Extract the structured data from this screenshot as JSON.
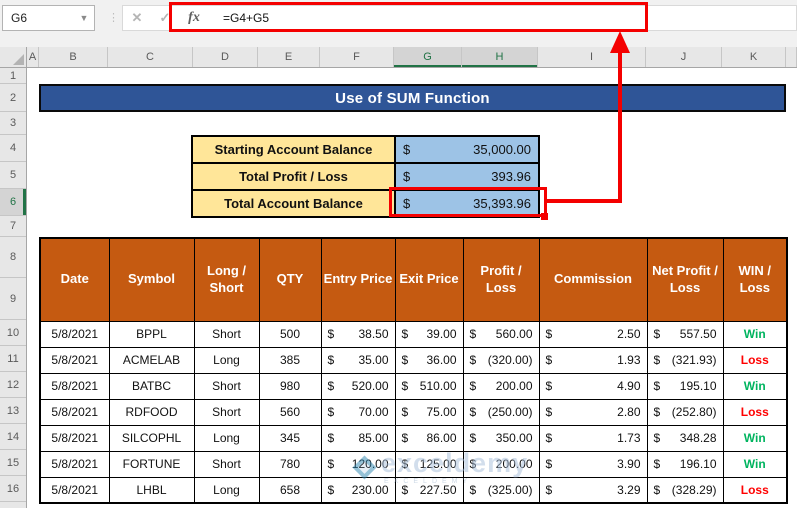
{
  "chrome": {
    "name_box": "G6",
    "dropdown_glyph": "▼",
    "dots_glyph": "⋮",
    "cancel_glyph": "✕",
    "enter_glyph": "✓",
    "fx_label": "fx",
    "formula": "=G4+G5"
  },
  "grid": {
    "col_letters": [
      "A",
      "B",
      "C",
      "D",
      "E",
      "F",
      "G",
      "H",
      "I",
      "J",
      "K"
    ],
    "selected_cols": [
      "G",
      "H"
    ],
    "row_numbers": [
      "1",
      "2",
      "3",
      "4",
      "5",
      "6",
      "7",
      "8",
      "9",
      "10",
      "11",
      "12",
      "13",
      "14",
      "15",
      "16"
    ],
    "selected_row": "6"
  },
  "banner": {
    "title": "Use of SUM Function"
  },
  "summary": {
    "currency": "$",
    "rows": [
      {
        "label": "Starting Account Balance",
        "value": "35,000.00",
        "highlighted": false
      },
      {
        "label": "Total Profit / Loss",
        "value": "393.96",
        "highlighted": false
      },
      {
        "label": "Total Account Balance",
        "value": "35,393.96",
        "highlighted": true
      }
    ]
  },
  "table": {
    "currency": "$",
    "headers": [
      "Date",
      "Symbol",
      "Long / Short",
      "QTY",
      "Entry Price",
      "Exit Price",
      "Profit / Loss",
      "Commission",
      "Net Profit / Loss",
      "WIN / Loss"
    ],
    "rows": [
      {
        "date": "5/8/2021",
        "symbol": "BPPL",
        "position": "Short",
        "qty": "500",
        "entry": "38.50",
        "exit": "39.00",
        "profit_loss": "560.00",
        "commission": "2.50",
        "net": "557.50",
        "result": "Win"
      },
      {
        "date": "5/8/2021",
        "symbol": "ACMELAB",
        "position": "Long",
        "qty": "385",
        "entry": "35.00",
        "exit": "36.00",
        "profit_loss": "(320.00)",
        "commission": "1.93",
        "net": "(321.93)",
        "result": "Loss"
      },
      {
        "date": "5/8/2021",
        "symbol": "BATBC",
        "position": "Short",
        "qty": "980",
        "entry": "520.00",
        "exit": "510.00",
        "profit_loss": "200.00",
        "commission": "4.90",
        "net": "195.10",
        "result": "Win"
      },
      {
        "date": "5/8/2021",
        "symbol": "RDFOOD",
        "position": "Short",
        "qty": "560",
        "entry": "70.00",
        "exit": "75.00",
        "profit_loss": "(250.00)",
        "commission": "2.80",
        "net": "(252.80)",
        "result": "Loss"
      },
      {
        "date": "5/8/2021",
        "symbol": "SILCOPHL",
        "position": "Long",
        "qty": "345",
        "entry": "85.00",
        "exit": "86.00",
        "profit_loss": "350.00",
        "commission": "1.73",
        "net": "348.28",
        "result": "Win"
      },
      {
        "date": "5/8/2021",
        "symbol": "FORTUNE",
        "position": "Short",
        "qty": "780",
        "entry": "120.00",
        "exit": "125.00",
        "profit_loss": "200.00",
        "commission": "3.90",
        "net": "196.10",
        "result": "Win"
      },
      {
        "date": "5/8/2021",
        "symbol": "LHBL",
        "position": "Long",
        "qty": "658",
        "entry": "230.00",
        "exit": "227.50",
        "profit_loss": "(325.00)",
        "commission": "3.29",
        "net": "(328.29)",
        "result": "Loss"
      }
    ]
  },
  "watermark": {
    "text": "exceldemy",
    "subtext": "EXCELDEMY"
  },
  "colors": {
    "banner_blue": "#2F5597",
    "header_orange": "#C55A11",
    "label_yellow": "#FFE699",
    "value_blue": "#9DC3E6",
    "win_green": "#00B45F",
    "loss_red": "#FF0000",
    "annotation_red": "#F40000",
    "selection_green": "#217346"
  }
}
